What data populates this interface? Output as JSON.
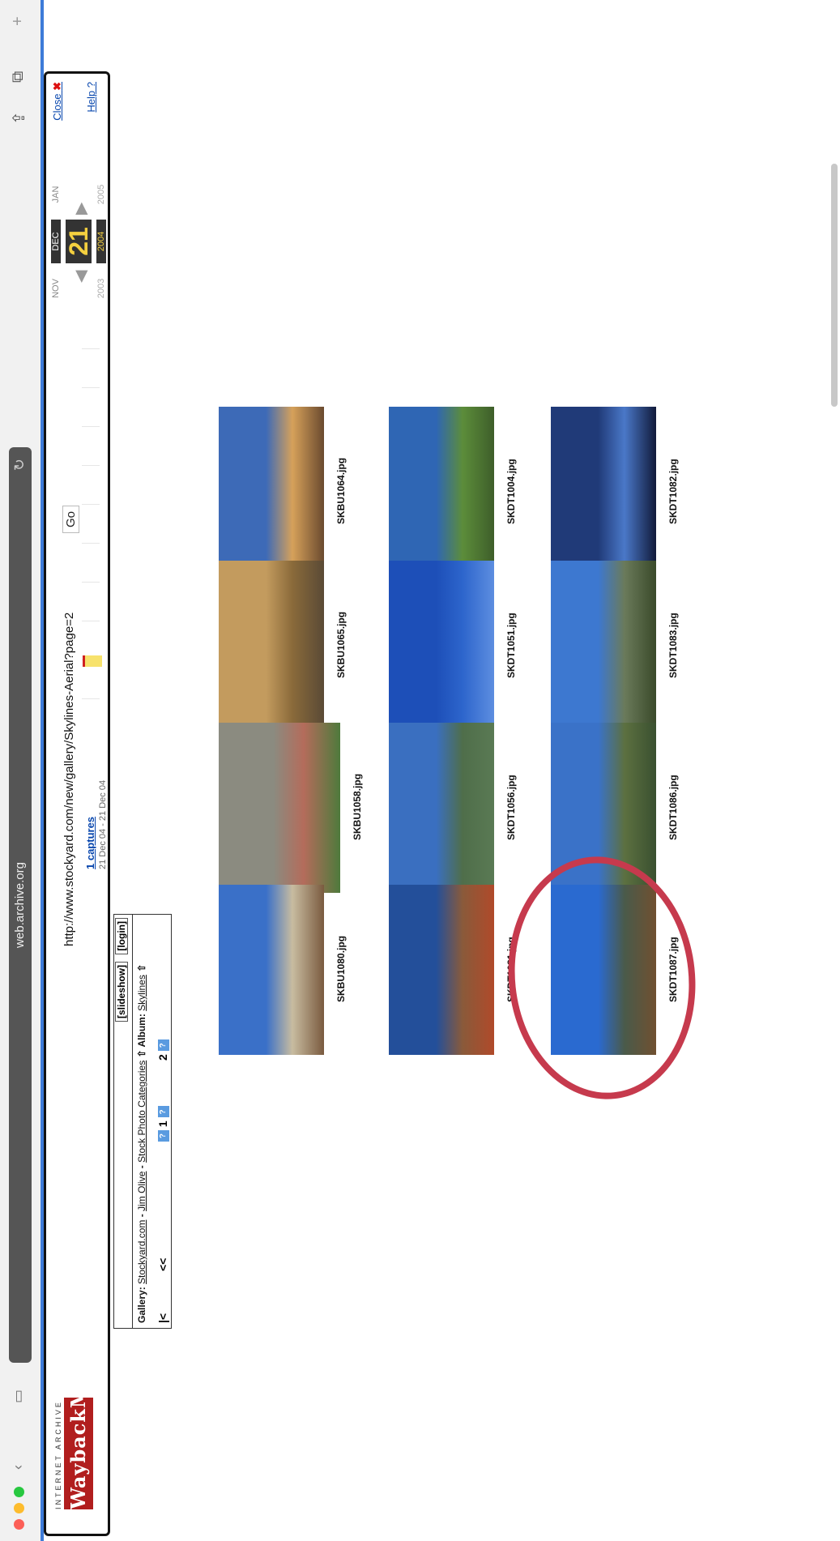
{
  "browser": {
    "host": "web.archive.org"
  },
  "wayback": {
    "logo_top": "INTERNET ARCHIVE",
    "logo": "WaybackMachine",
    "url": "http://www.stockyard.com/new/gallery/Skylines-Aerial?page=2",
    "go": "Go",
    "captures_link": "1 captures",
    "captures_range": "21 Dec 04 - 21 Dec 04",
    "months": [
      "NOV",
      "DEC",
      "JAN"
    ],
    "day": "21",
    "years": [
      "2003",
      "2004",
      "2005"
    ],
    "close": "Close",
    "help": "Help ?"
  },
  "gallery": {
    "buttons": [
      "[slideshow]",
      "[login]"
    ],
    "gallery_label": "Gallery:",
    "crumb_1": "Stockyard.com",
    "crumb_sep_1": " - ",
    "crumb_2": "Jim Olive",
    "crumb_sep_2": " - ",
    "crumb_3": "Stock Photo Categories",
    "album_label": "Album:",
    "album": "Skylines",
    "first": "|<",
    "prev": "<<",
    "page_1": "1",
    "page_2": "2",
    "pg_icon": "?"
  },
  "photos": [
    {
      "file": "SKBU1064.jpg",
      "colors": [
        "#3d6ab7",
        "#d6a15a",
        "#6a4a2f"
      ]
    },
    {
      "file": "SKBU1065.jpg",
      "colors": [
        "#c39b5e",
        "#8a6a3a",
        "#5a4a36"
      ]
    },
    {
      "file": "SKBU1058.jpg",
      "colors": [
        "#8b8b80",
        "#b46c5b",
        "#4e7a3c"
      ]
    },
    {
      "file": "SKBU1080.jpg",
      "colors": [
        "#3a70c8",
        "#c8bca0",
        "#7a5a3f"
      ]
    },
    {
      "file": "SKDT1004.jpg",
      "colors": [
        "#2f66b4",
        "#5c8d3a",
        "#3e5e2a"
      ]
    },
    {
      "file": "SKDT1051.jpg",
      "colors": [
        "#1d4fb8",
        "#2d65cc",
        "#5d8ee0"
      ]
    },
    {
      "file": "SKDT1056.jpg",
      "colors": [
        "#3a6fc0",
        "#4f6e4a",
        "#5a7a54"
      ]
    },
    {
      "file": "SKDT1081.jpg",
      "colors": [
        "#234f9a",
        "#8a5a3a",
        "#b04a2a"
      ]
    },
    {
      "file": "SKDT1082.jpg",
      "colors": [
        "#203a78",
        "#4a78c8",
        "#111a3a"
      ]
    },
    {
      "file": "SKDT1083.jpg",
      "colors": [
        "#3d78d0",
        "#6a7a5a",
        "#3a4a2a"
      ]
    },
    {
      "file": "SKDT1086.jpg",
      "colors": [
        "#3a72c8",
        "#5c7040",
        "#3a5030"
      ]
    },
    {
      "file": "SKDT1087.jpg",
      "colors": [
        "#2a6ad0",
        "#4a5a4a",
        "#705030"
      ]
    }
  ]
}
